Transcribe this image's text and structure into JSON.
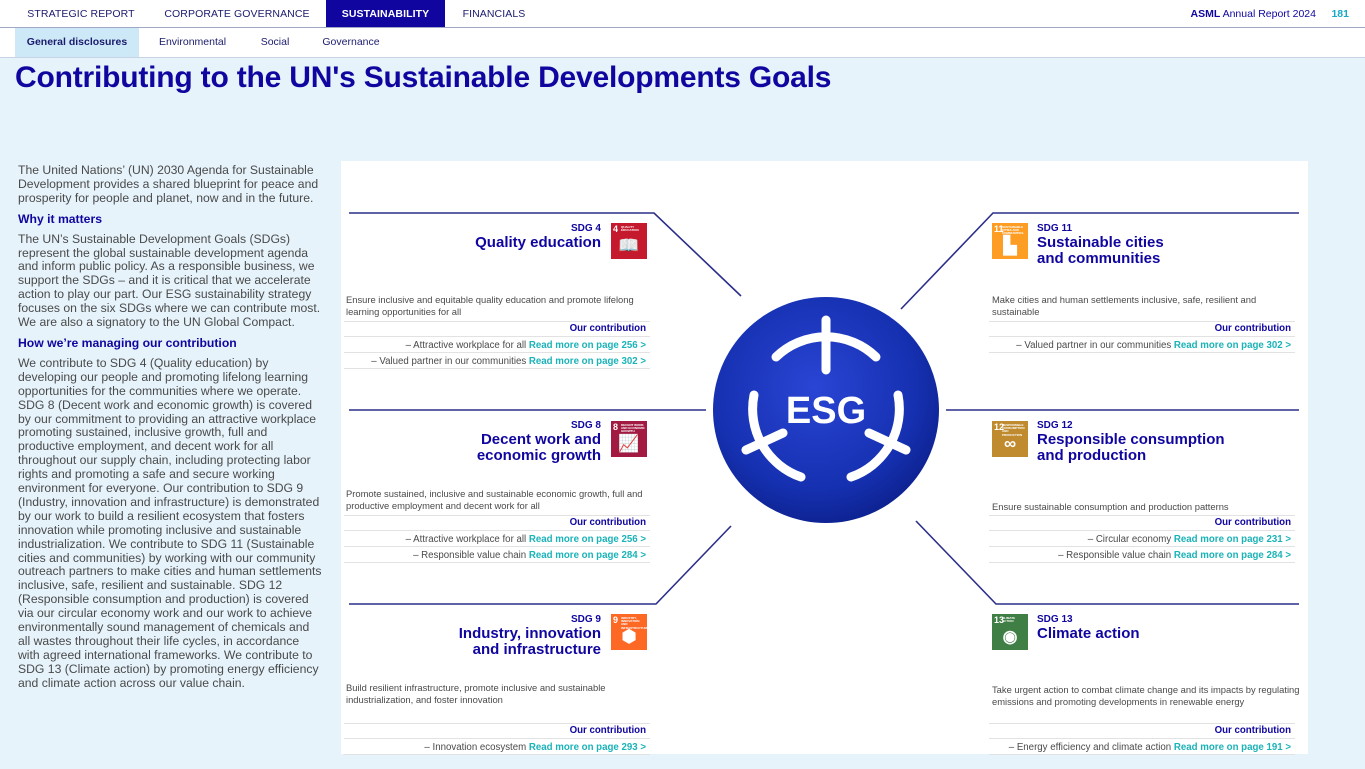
{
  "nav": {
    "tabs": [
      {
        "label": "STRATEGIC REPORT"
      },
      {
        "label": "CORPORATE GOVERNANCE"
      },
      {
        "label": "SUSTAINABILITY"
      },
      {
        "label": "FINANCIALS"
      }
    ],
    "brand_bold": "ASML",
    "brand_rest": " Annual Report 2024",
    "page_number": "181"
  },
  "subnav": {
    "tabs": [
      {
        "label": "General disclosures"
      },
      {
        "label": "Environmental"
      },
      {
        "label": "Social"
      },
      {
        "label": "Governance"
      }
    ]
  },
  "page_title": "Contributing to the UN's Sustainable Developments Goals",
  "left": {
    "intro": "The United Nations’ (UN) 2030 Agenda for Sustainable Development provides a shared blueprint for peace and prosperity for people and planet, now and in the future.",
    "why_heading": "Why it matters",
    "why_text": "The UN’s Sustainable Development Goals (SDGs) represent the global sustainable development agenda and inform public policy. As a responsible business, we support the SDGs – and it is critical that we accelerate action to play our part. Our ESG sustainability strategy focuses on the six SDGs where we can contribute most. We are also a signatory to the UN Global Compact.",
    "how_heading": "How we’re managing our contribution",
    "how_text": "We contribute to SDG 4 (Quality education) by developing our people and promoting lifelong learning opportunities for the communities where we operate. SDG 8 (Decent work and economic growth) is covered by our commitment to providing an attractive workplace promoting sustained, inclusive growth, full and productive employment, and decent work for all throughout our supply chain, including protecting labor rights and promoting a safe and secure working environment for everyone. Our contribution to SDG 9 (Industry, innovation and infrastructure) is demonstrated by our work to build a resilient ecosystem that fosters innovation while promoting inclusive and sustainable industrialization. We contribute to SDG 11 (Sustainable cities and communities) by working with our community outreach partners to make cities and human settlements inclusive, safe, resilient and sustainable. SDG 12 (Responsible consumption and production) is covered via our circular economy work and our work to achieve environmentally sound management of chemicals and all wastes throughout their life cycles, in accordance with agreed international frameworks. We contribute to SDG 13 (Climate action) by promoting energy efficiency and climate action across our value chain."
  },
  "center_label": "ESG",
  "contribution_heading": "Our contribution",
  "sdgs": [
    {
      "num": "SDG 4",
      "title1": "Quality education",
      "title2": "",
      "icon_num": "4",
      "icon_caption": "QUALITY EDUCATION",
      "icon_glyph": "📖",
      "color": "#c5192d",
      "description": "Ensure inclusive and equitable quality education and promote lifelong learning opportunities for all",
      "items": [
        {
          "text": "– Attractive workplace for all ",
          "link": "Read more on page 256  >"
        },
        {
          "text": "– Valued partner in our communities ",
          "link": "Read more on page 302 >"
        }
      ]
    },
    {
      "num": "SDG 8",
      "title1": "Decent work and",
      "title2": "economic growth",
      "icon_num": "8",
      "icon_caption": "DECENT WORK AND ECONOMIC GROWTH",
      "icon_glyph": "📈",
      "color": "#a21942",
      "description": "Promote sustained, inclusive and sustainable economic growth, full and productive employment and decent work for all",
      "items": [
        {
          "text": "– Attractive workplace for all ",
          "link": "Read more on page 256  >"
        },
        {
          "text": "– Responsible value chain ",
          "link": "Read more on page 284  >"
        }
      ]
    },
    {
      "num": "SDG 9",
      "title1": "Industry, innovation",
      "title2": "and infrastructure",
      "icon_num": "9",
      "icon_caption": "INDUSTRY, INNOVATION AND INFRASTRUCTURE",
      "icon_glyph": "⬢",
      "color": "#fd6925",
      "description": "Build resilient infrastructure, promote inclusive and sustainable industrialization, and foster innovation",
      "items": [
        {
          "text": "– Innovation ecosystem ",
          "link": "Read more on page 293 >"
        }
      ]
    },
    {
      "num": "SDG 11",
      "title1": "Sustainable cities",
      "title2": "and communities",
      "icon_num": "11",
      "icon_caption": "SUSTAINABLE CITIES AND COMMUNITIES",
      "icon_glyph": "▙",
      "color": "#fd9d24",
      "description": "Make cities and human settlements inclusive, safe, resilient and sustainable",
      "items": [
        {
          "text": "– Valued partner in our communities ",
          "link": "Read more on page 302 >"
        }
      ]
    },
    {
      "num": "SDG 12",
      "title1": "Responsible consumption",
      "title2": "and production",
      "icon_num": "12",
      "icon_caption": "RESPONSIBLE CONSUMPTION AND PRODUCTION",
      "icon_glyph": "∞",
      "color": "#bf8b2e",
      "description": "Ensure sustainable consumption and production patterns",
      "items": [
        {
          "text": "– Circular economy ",
          "link": "Read more on page 231  >"
        },
        {
          "text": "– Responsible value chain ",
          "link": "Read more on page 284  >"
        }
      ]
    },
    {
      "num": "SDG 13",
      "title1": "Climate action",
      "title2": "",
      "icon_num": "13",
      "icon_caption": "CLIMATE ACTION",
      "icon_glyph": "◉",
      "color": "#3f7e44",
      "description": "Take urgent action to combat climate change and its impacts by regulating emissions and promoting developments in renewable energy",
      "items": [
        {
          "text": "– Energy efficiency and climate action ",
          "link": "Read more on page 191 >"
        }
      ]
    }
  ]
}
